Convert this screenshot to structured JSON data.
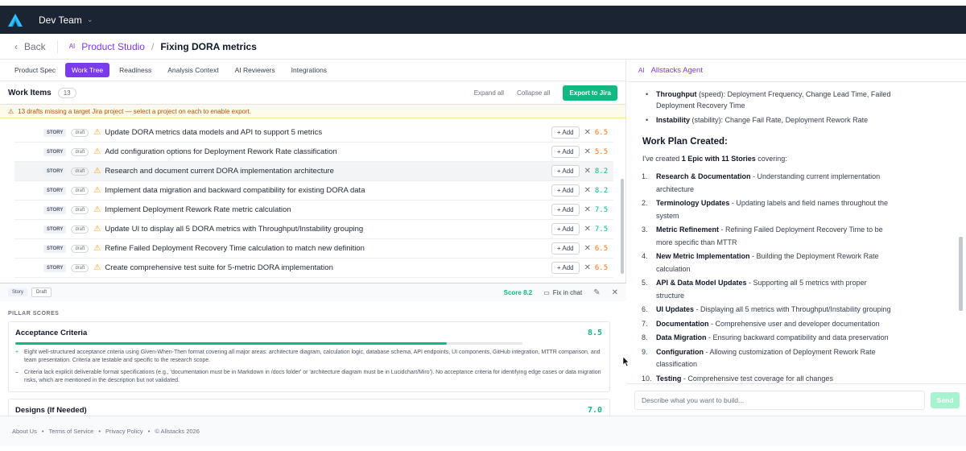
{
  "topbar": {
    "team": "Dev Team",
    "colors": {
      "bg": "#1b2433",
      "logo": "#38bdf8"
    }
  },
  "breadcrumb": {
    "back": "Back",
    "ai_tag": "AI",
    "studio": "Product Studio",
    "current": "Fixing DORA metrics"
  },
  "tabs": [
    "Product Spec",
    "Work Tree",
    "Readiness",
    "Analysis Context",
    "AI Reviewers",
    "Integrations"
  ],
  "active_tab": "Work Tree",
  "work_items": {
    "title": "Work Items",
    "count": "13",
    "expand": "Expand all",
    "collapse": "Collapse all",
    "export": "Export to Jira",
    "warning": "13 drafts missing a target Jira project — select a project on each to enable export.",
    "type_label": "STORY",
    "status_label": "draft",
    "add_label": "+ Add",
    "rows": [
      {
        "title": "Update DORA metrics data models and API to support 5 metrics",
        "score": "6.5"
      },
      {
        "title": "Add configuration options for Deployment Rework Rate classification",
        "score": "5.5"
      },
      {
        "title": "Research and document current DORA implementation architecture",
        "score": "8.2"
      },
      {
        "title": "Implement data migration and backward compatibility for existing DORA data",
        "score": "8.2"
      },
      {
        "title": "Implement Deployment Rework Rate metric calculation",
        "score": "7.5"
      },
      {
        "title": "Update UI to display all 5 DORA metrics with Throughput/Instability grouping",
        "score": "7.5"
      },
      {
        "title": "Refine Failed Deployment Recovery Time calculation to match new definition",
        "score": "6.5"
      },
      {
        "title": "Create comprehensive test suite for 5-metric DORA implementation",
        "score": "6.5"
      }
    ]
  },
  "detail": {
    "type": "Story",
    "status": "Draft",
    "score": "Score 8.2",
    "fix": "Fix in chat",
    "pillar_label": "PILLAR SCORES",
    "pillars": [
      {
        "name": "Acceptance Criteria",
        "score": "8.5",
        "level": 0.85,
        "plus": "Eight well-structured acceptance criteria using Given-When-Then format covering all major areas: architecture diagram, calculation logic, database schema, API endpoints, UI components, GitHub integration, MTTR comparison, and team presentation. Criteria are testable and specific to the research scope.",
        "minus": "Criteria lack explicit deliverable format specifications (e.g., 'documentation must be in Markdown in /docs folder' or 'architecture diagram must be in Lucidchart/Miro'). No acceptance criteria for identifying edge cases or data migration risks, which are mentioned in the description but not validated."
      },
      {
        "name": "Designs (If Needed)",
        "score": "7.0",
        "level": 0.7
      }
    ]
  },
  "agent": {
    "ai_tag": "AI",
    "title": "Allstacks Agent",
    "bullets": [
      {
        "b": "Throughput",
        "t": " (speed): Deployment Frequency, Change Lead Time, Failed Deployment Recovery Time"
      },
      {
        "b": "Instability",
        "t": " (stability): Change Fail Rate, Deployment Rework Rate"
      }
    ],
    "work_plan": "Work Plan Created:",
    "intro_pre": "I've created ",
    "intro_bold": "1 Epic with 11 Stories",
    "intro_post": " covering:",
    "plan": [
      {
        "n": "1.",
        "b": "Research & Documentation",
        "t": " - Understanding current implementation architecture"
      },
      {
        "n": "2.",
        "b": "Terminology Updates",
        "t": " - Updating labels and field names throughout the system"
      },
      {
        "n": "3.",
        "b": "Metric Refinement",
        "t": " - Refining Failed Deployment Recovery Time to be more specific than MTTR"
      },
      {
        "n": "4.",
        "b": "New Metric Implementation",
        "t": " - Building the Deployment Rework Rate calculation"
      },
      {
        "n": "5.",
        "b": "API & Data Model Updates",
        "t": " - Supporting all 5 metrics with proper structure"
      },
      {
        "n": "6.",
        "b": "UI Updates",
        "t": " - Displaying all 5 metrics with Throughput/Instability grouping"
      },
      {
        "n": "7.",
        "b": "Documentation",
        "t": " - Comprehensive user and developer documentation"
      },
      {
        "n": "8.",
        "b": "Data Migration",
        "t": " - Ensuring backward compatibility and data preservation"
      },
      {
        "n": "9.",
        "b": "Configuration",
        "t": " - Allowing customization of Deployment Rework Rate classification"
      },
      {
        "n": "10.",
        "b": "Testing",
        "t": " - Comprehensive test coverage for all changes"
      }
    ],
    "placeholder": "Describe what you want to build...",
    "send": "Send"
  },
  "footer": {
    "links": [
      "About Us",
      "Terms of Service",
      "Privacy Policy"
    ],
    "copyright": "© Allstacks 2026",
    "sep": "•"
  },
  "icons": {
    "back": "chevron-left-icon",
    "team": "chevron-down-icon",
    "warn": "warning-icon",
    "remove": "close-icon",
    "edit": "pencil-icon",
    "fix": "chat-icon"
  },
  "colors": {
    "accent": "#7c3aed",
    "success": "#10b981",
    "warning": "#f59e0b",
    "score_low": "#f97316"
  }
}
